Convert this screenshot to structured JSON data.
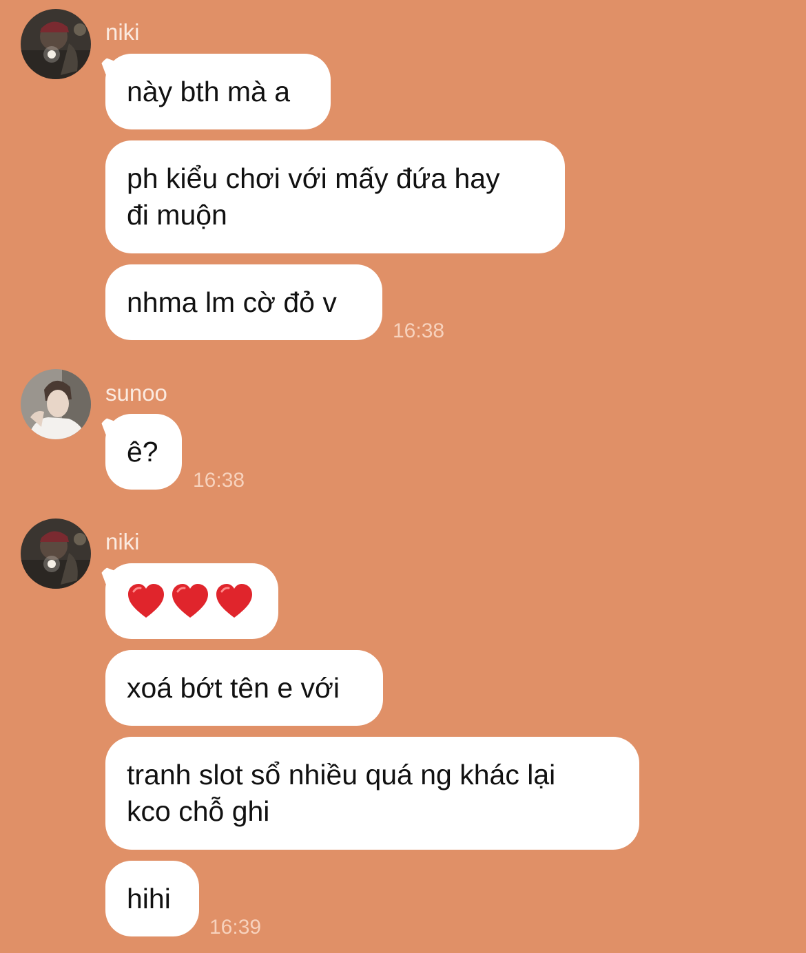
{
  "colors": {
    "background": "#e09067",
    "bubble": "#ffffff",
    "text": "#111111",
    "name": "#fbeae0",
    "time": "#f7d2bd",
    "heart": "#e0252c"
  },
  "groups": [
    {
      "sender": "niki",
      "avatar": "profile-photo-niki",
      "messages": [
        "này bth mà a",
        "ph kiểu chơi với mấy đứa hay\nđi muộn",
        "nhma lm cờ đỏ v"
      ],
      "time": "16:38"
    },
    {
      "sender": "sunoo",
      "avatar": "profile-photo-sunoo",
      "messages": [
        "ê?"
      ],
      "time": "16:38"
    },
    {
      "sender": "niki",
      "avatar": "profile-photo-niki",
      "messages": [
        "❤️❤️❤️",
        "xoá bớt tên e với",
        "tranh slot sổ nhiều quá ng khác lại\nkco chỗ ghi",
        "hihi"
      ],
      "time": "16:39"
    }
  ]
}
